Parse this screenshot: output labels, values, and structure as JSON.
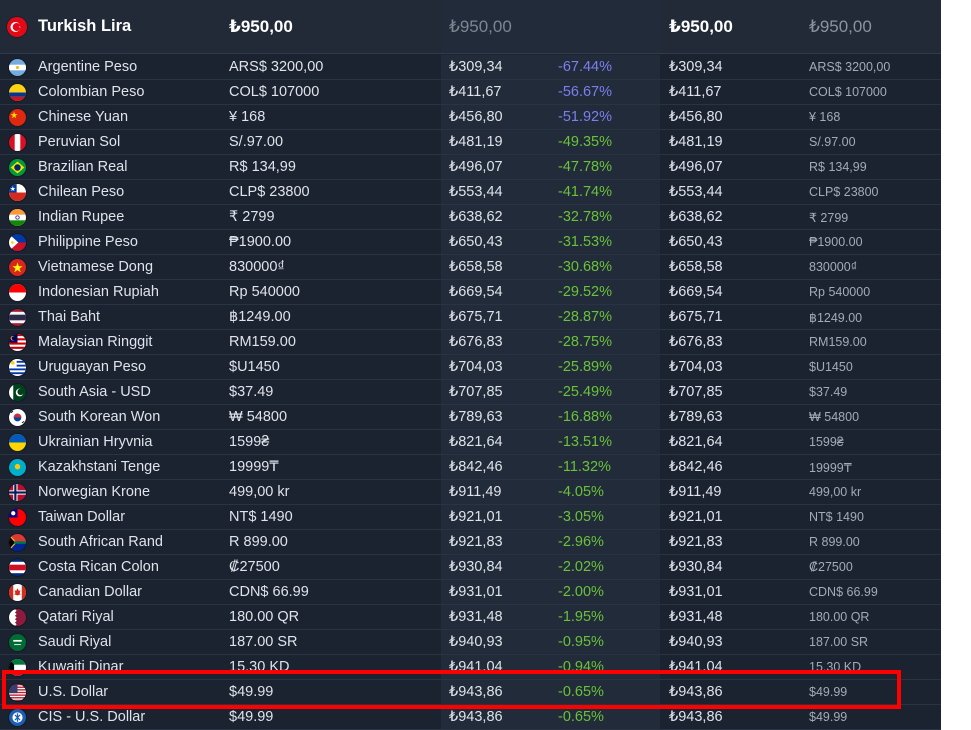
{
  "header": {
    "currency": "Turkish Lira",
    "flag_icon": "flag-tr-icon",
    "original_price": "₺950,00",
    "converted_price": "₺950,00",
    "converted_price_2": "₺950,00",
    "original_price_2": "₺950,00"
  },
  "rows": [
    {
      "currency": "Argentine Peso",
      "flag_icon": "flag-ar-icon",
      "price": "ARS$ 3200,00",
      "converted": "₺309,34",
      "diff": "-67.44%",
      "diff_tone": "neg"
    },
    {
      "currency": "Colombian Peso",
      "flag_icon": "flag-co-icon",
      "price": "COL$ 107000",
      "converted": "₺411,67",
      "diff": "-56.67%",
      "diff_tone": "neg"
    },
    {
      "currency": "Chinese Yuan",
      "flag_icon": "flag-cn-icon",
      "price": "¥ 168",
      "converted": "₺456,80",
      "diff": "-51.92%",
      "diff_tone": "neg"
    },
    {
      "currency": "Peruvian Sol",
      "flag_icon": "flag-pe-icon",
      "price": "S/.97.00",
      "converted": "₺481,19",
      "diff": "-49.35%",
      "diff_tone": "pos"
    },
    {
      "currency": "Brazilian Real",
      "flag_icon": "flag-br-icon",
      "price": "R$ 134,99",
      "converted": "₺496,07",
      "diff": "-47.78%",
      "diff_tone": "pos"
    },
    {
      "currency": "Chilean Peso",
      "flag_icon": "flag-cl-icon",
      "price": "CLP$ 23800",
      "converted": "₺553,44",
      "diff": "-41.74%",
      "diff_tone": "pos"
    },
    {
      "currency": "Indian Rupee",
      "flag_icon": "flag-in-icon",
      "price": "₹ 2799",
      "converted": "₺638,62",
      "diff": "-32.78%",
      "diff_tone": "pos"
    },
    {
      "currency": "Philippine Peso",
      "flag_icon": "flag-ph-icon",
      "price": "₱1900.00",
      "converted": "₺650,43",
      "diff": "-31.53%",
      "diff_tone": "pos"
    },
    {
      "currency": "Vietnamese Dong",
      "flag_icon": "flag-vn-icon",
      "price": "830000₫",
      "converted": "₺658,58",
      "diff": "-30.68%",
      "diff_tone": "pos"
    },
    {
      "currency": "Indonesian Rupiah",
      "flag_icon": "flag-id-icon",
      "price": "Rp 540000",
      "converted": "₺669,54",
      "diff": "-29.52%",
      "diff_tone": "pos"
    },
    {
      "currency": "Thai Baht",
      "flag_icon": "flag-th-icon",
      "price": "฿1249.00",
      "converted": "₺675,71",
      "diff": "-28.87%",
      "diff_tone": "pos"
    },
    {
      "currency": "Malaysian Ringgit",
      "flag_icon": "flag-my-icon",
      "price": "RM159.00",
      "converted": "₺676,83",
      "diff": "-28.75%",
      "diff_tone": "pos"
    },
    {
      "currency": "Uruguayan Peso",
      "flag_icon": "flag-uy-icon",
      "price": "$U1450",
      "converted": "₺704,03",
      "diff": "-25.89%",
      "diff_tone": "pos"
    },
    {
      "currency": "South Asia - USD",
      "flag_icon": "flag-pk-icon",
      "price": "$37.49",
      "converted": "₺707,85",
      "diff": "-25.49%",
      "diff_tone": "pos"
    },
    {
      "currency": "South Korean Won",
      "flag_icon": "flag-kr-icon",
      "price": "₩ 54800",
      "converted": "₺789,63",
      "diff": "-16.88%",
      "diff_tone": "pos"
    },
    {
      "currency": "Ukrainian Hryvnia",
      "flag_icon": "flag-ua-icon",
      "price": "1599₴",
      "converted": "₺821,64",
      "diff": "-13.51%",
      "diff_tone": "pos"
    },
    {
      "currency": "Kazakhstani Tenge",
      "flag_icon": "flag-kz-icon",
      "price": "19999₸",
      "converted": "₺842,46",
      "diff": "-11.32%",
      "diff_tone": "pos"
    },
    {
      "currency": "Norwegian Krone",
      "flag_icon": "flag-no-icon",
      "price": "499,00 kr",
      "converted": "₺911,49",
      "diff": "-4.05%",
      "diff_tone": "pos"
    },
    {
      "currency": "Taiwan Dollar",
      "flag_icon": "flag-tw-icon",
      "price": "NT$ 1490",
      "converted": "₺921,01",
      "diff": "-3.05%",
      "diff_tone": "pos"
    },
    {
      "currency": "South African Rand",
      "flag_icon": "flag-za-icon",
      "price": "R 899.00",
      "converted": "₺921,83",
      "diff": "-2.96%",
      "diff_tone": "pos"
    },
    {
      "currency": "Costa Rican Colon",
      "flag_icon": "flag-cr-icon",
      "price": "₡27500",
      "converted": "₺930,84",
      "diff": "-2.02%",
      "diff_tone": "pos"
    },
    {
      "currency": "Canadian Dollar",
      "flag_icon": "flag-ca-icon",
      "price": "CDN$ 66.99",
      "converted": "₺931,01",
      "diff": "-2.00%",
      "diff_tone": "pos"
    },
    {
      "currency": "Qatari Riyal",
      "flag_icon": "flag-qa-icon",
      "price": "180.00 QR",
      "converted": "₺931,48",
      "diff": "-1.95%",
      "diff_tone": "pos"
    },
    {
      "currency": "Saudi Riyal",
      "flag_icon": "flag-sa-icon",
      "price": "187.00 SR",
      "converted": "₺940,93",
      "diff": "-0.95%",
      "diff_tone": "pos"
    },
    {
      "currency": "Kuwaiti Dinar",
      "flag_icon": "flag-kw-icon",
      "price": "15.30 KD",
      "converted": "₺941,04",
      "diff": "-0.94%",
      "diff_tone": "pos"
    },
    {
      "currency": "U.S. Dollar",
      "flag_icon": "flag-us-icon",
      "price": "$49.99",
      "converted": "₺943,86",
      "diff": "-0.65%",
      "diff_tone": "pos"
    },
    {
      "currency": "CIS - U.S. Dollar",
      "flag_icon": "flag-cis-icon",
      "price": "$49.99",
      "converted": "₺943,86",
      "diff": "-0.65%",
      "diff_tone": "pos"
    }
  ],
  "colors": {
    "table_bg": "#1b2230",
    "header_bg": "#222a38",
    "converted_column_bg": "#222b39",
    "positive_diff": "#6ac23b",
    "negative_diff": "#7b7ff0",
    "highlight_border": "#ff0000"
  }
}
